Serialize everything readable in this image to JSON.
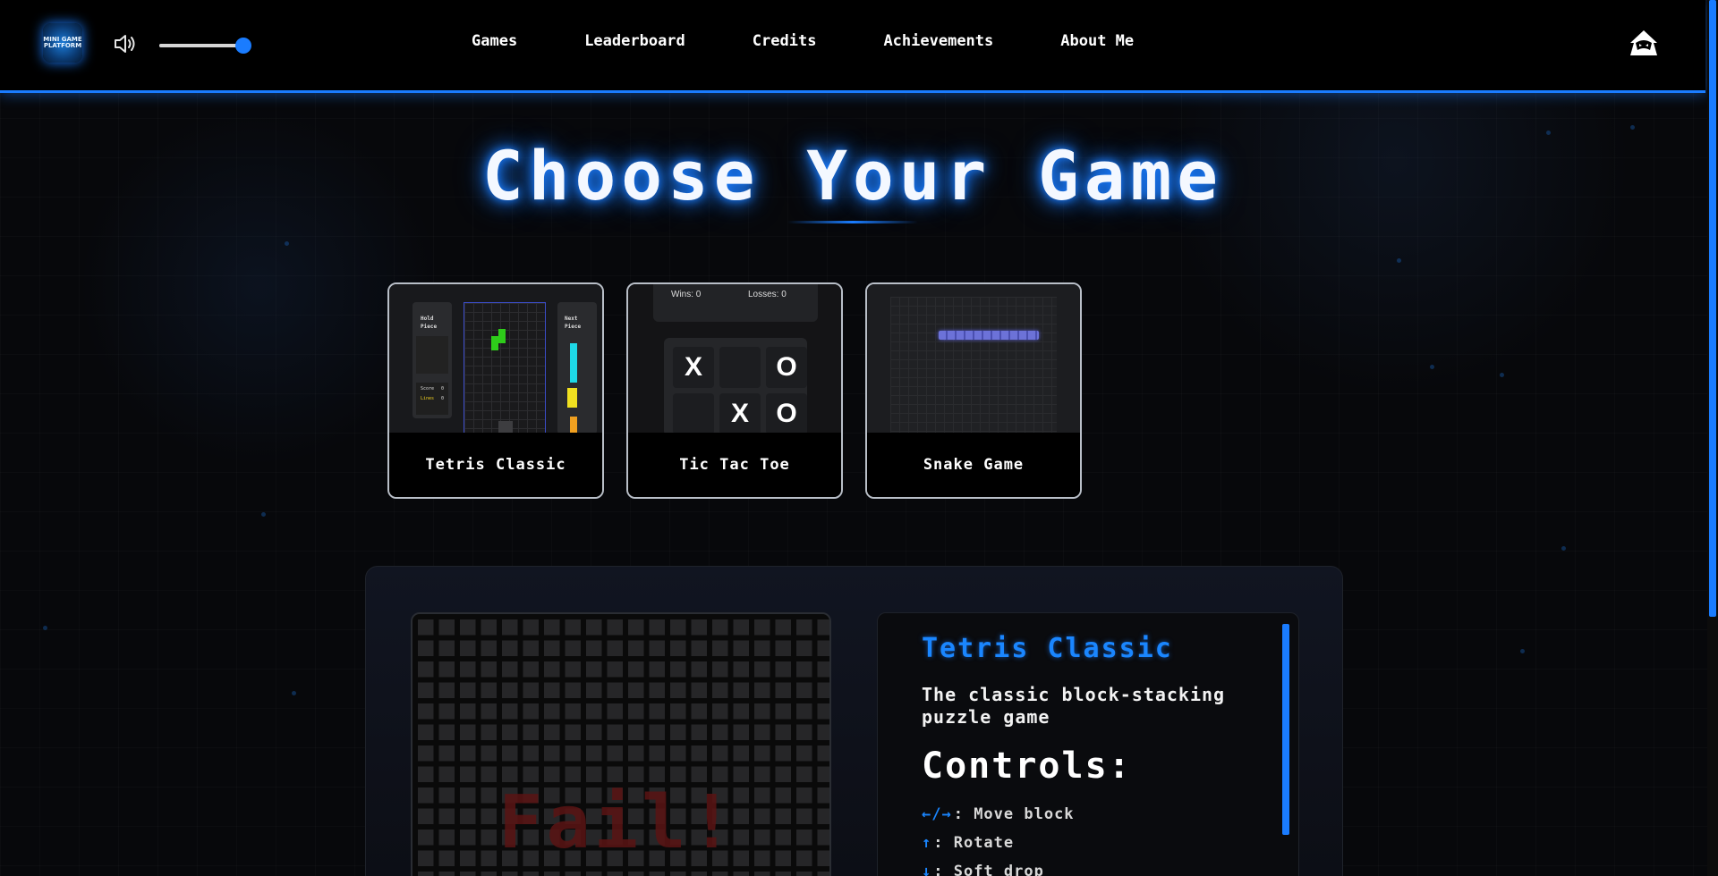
{
  "header": {
    "logo_text": "MINI GAME PLATFORM",
    "volume_percent": 100,
    "nav": [
      "Games",
      "Leaderboard",
      "Credits",
      "Achievements",
      "About Me"
    ]
  },
  "page_title": "Choose Your Game",
  "games": [
    {
      "name": "Tetris Classic",
      "preview": {
        "hold_label": "Hold Piece",
        "next_label": "Next Piece",
        "score_label": "Score",
        "lines_label": "Lines",
        "score_value": "0",
        "lines_value": "0"
      }
    },
    {
      "name": "Tic Tac Toe",
      "preview": {
        "wins": "Wins: 0",
        "losses": "Losses: 0",
        "cells": [
          "X",
          "",
          "O",
          "",
          "X",
          "O"
        ]
      }
    },
    {
      "name": "Snake Game",
      "preview": {}
    }
  ],
  "board": {
    "overlay_text": "Fail!"
  },
  "details": {
    "title": "Tetris Classic",
    "description": "The classic block-stacking puzzle game",
    "controls_heading": "Controls:",
    "controls": [
      {
        "key": "←/→",
        "action": ": Move block"
      },
      {
        "key": "↑",
        "action": ": Rotate"
      },
      {
        "key": "↓",
        "action": ": Soft drop"
      }
    ]
  },
  "colors": {
    "accent": "#1a7cff",
    "background": "#07080b",
    "fail_text": "#5a1414"
  }
}
